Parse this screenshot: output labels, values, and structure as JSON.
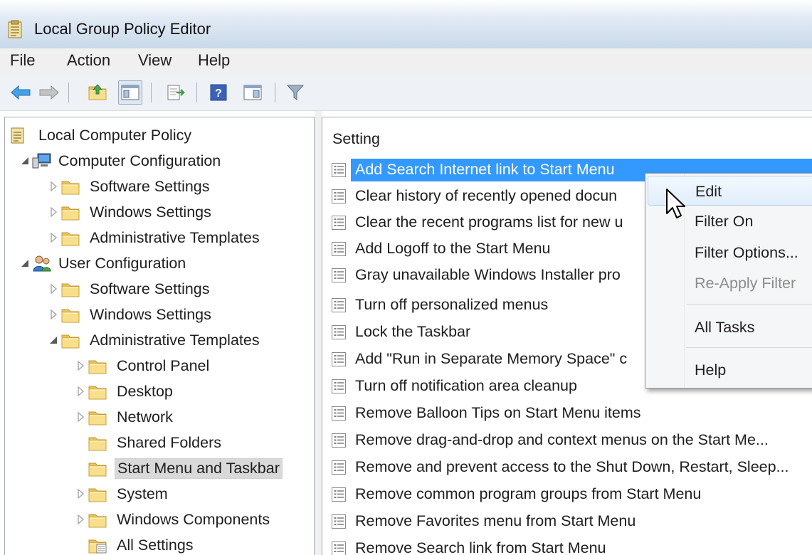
{
  "window": {
    "title": "Local Group Policy Editor",
    "icon": "policy-editor-icon"
  },
  "menubar": {
    "items": [
      "File",
      "Action",
      "View",
      "Help"
    ]
  },
  "toolbar": {
    "buttons": [
      "back-arrow-icon",
      "forward-arrow-icon",
      "up-folder-icon",
      "show-hide-tree-icon",
      "export-list-icon",
      "help-icon",
      "show-hide-action-pane-icon",
      "filter-icon"
    ]
  },
  "tree": {
    "root": "Local Computer Policy",
    "computer_configuration": "Computer Configuration",
    "computer_children": [
      "Software Settings",
      "Windows Settings",
      "Administrative Templates"
    ],
    "user_configuration": "User Configuration",
    "user_children": [
      "Software Settings",
      "Windows Settings",
      "Administrative Templates"
    ],
    "admin_templates_children": [
      "Control Panel",
      "Desktop",
      "Network",
      "Shared Folders",
      "Start Menu and Taskbar",
      "System",
      "Windows Components"
    ],
    "all_settings": "All Settings",
    "selected": "Start Menu and Taskbar"
  },
  "settings_list": {
    "column_header": "Setting",
    "rows": [
      "Add Search Internet link to Start Menu",
      "Clear history of recently opened docun",
      "Clear the recent programs list for new u",
      "Add Logoff to the Start Menu",
      "Gray unavailable Windows Installer pro",
      "Turn off personalized menus",
      "Lock the Taskbar",
      "Add \"Run in Separate Memory Space\" c",
      "Turn off notification area cleanup",
      "Remove Balloon Tips on Start Menu items",
      "Remove drag-and-drop and context menus on the Start Me...",
      "Remove and prevent access to the Shut Down, Restart, Sleep...",
      "Remove common program groups from Start Menu",
      "Remove Favorites menu from Start Menu",
      "Remove Search link from Start Menu"
    ],
    "selected_index": 0
  },
  "context_menu": {
    "items": [
      {
        "label": "Edit",
        "state": "hover"
      },
      {
        "label": "Filter On",
        "state": "normal"
      },
      {
        "label": "Filter Options...",
        "state": "normal"
      },
      {
        "label": "Re-Apply Filter",
        "state": "disabled"
      },
      {
        "label": "All Tasks",
        "state": "normal"
      },
      {
        "label": "Help",
        "state": "normal"
      }
    ]
  },
  "colors": {
    "selection": "#3399ff",
    "title_gradient_end": "#c9d9ea",
    "folder": "#f5d77a"
  }
}
